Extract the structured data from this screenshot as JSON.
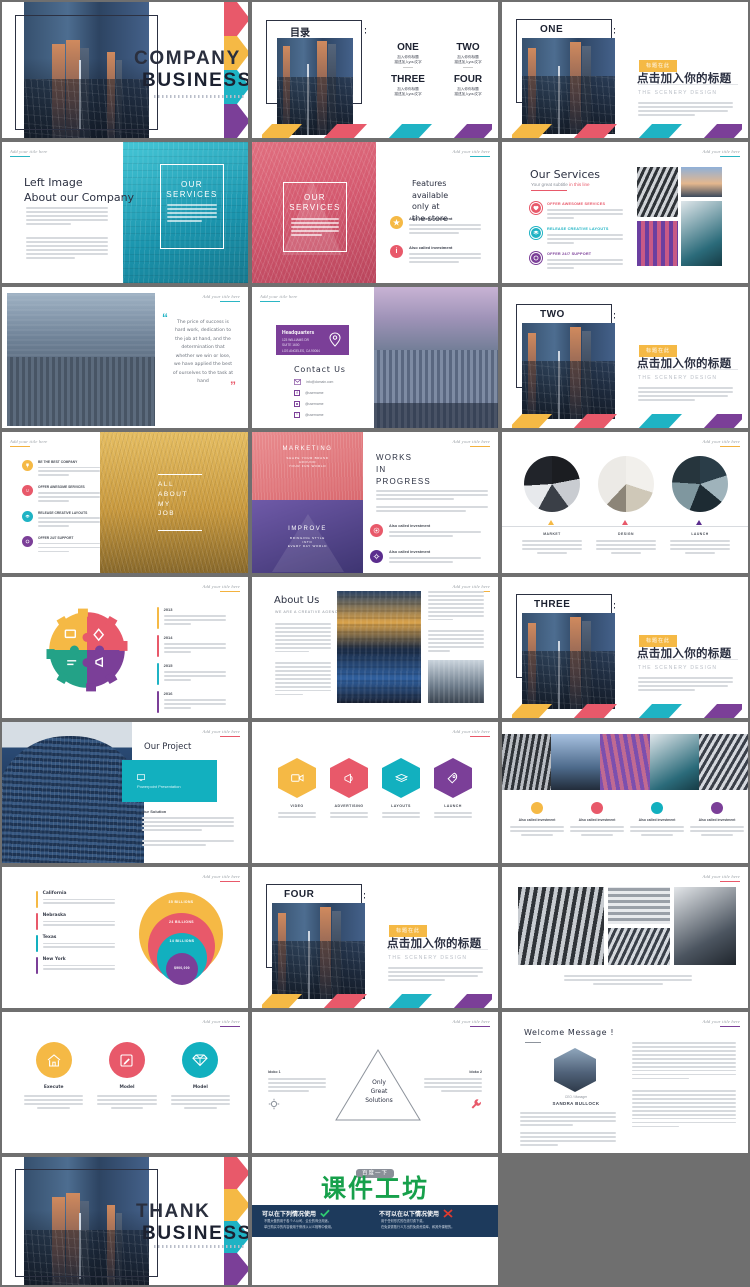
{
  "meta": {
    "accent_gold": "#f5b945",
    "accent_red": "#e8596a",
    "accent_teal": "#1fb3c4",
    "accent_purple": "#7b3f98",
    "ink": "#2c3142"
  },
  "common": {
    "add_title": "Add your title here"
  },
  "slides": {
    "cover": {
      "line1": "COMPANY",
      "line2": "BUSINESS"
    },
    "toc": {
      "title": "目录",
      "items": [
        {
          "num": "ONE",
          "l1": "加入你你标题",
          "l2": "描述加入you文字"
        },
        {
          "num": "TWO",
          "l1": "加入你你标题",
          "l2": "描述加入you文字"
        },
        {
          "num": "THREE",
          "l1": "加入你你标题",
          "l2": "描述加入you文字"
        },
        {
          "num": "FOUR",
          "l1": "加入你你标题",
          "l2": "描述加入you文字"
        }
      ]
    },
    "section_one": {
      "label": "ONE",
      "badge": "标题在此",
      "title": "点击加入你的标题",
      "sub": "THE SCENERY DESIGN"
    },
    "section_two": {
      "label": "TWO",
      "badge": "标题在此",
      "title": "点击加入你的标题",
      "sub": "THE SCENERY DESIGN"
    },
    "section_three": {
      "label": "THREE",
      "badge": "标题在此",
      "title": "点击加入你的标题",
      "sub": "THE SCENERY DESIGN"
    },
    "section_four": {
      "label": "FOUR",
      "badge": "标题在此",
      "title": "点击加入你的标题",
      "sub": "THE SCENERY DESIGN"
    },
    "left_image": {
      "title1": "Left Image",
      "title2": "About our Company",
      "overlay_title1": "OUR",
      "overlay_title2": "SERVICES"
    },
    "our_services_red": {
      "overlay_title1": "OUR",
      "overlay_title2": "SERVICES",
      "heading": [
        "Features",
        "available",
        "only at",
        "the store"
      ],
      "items": [
        {
          "label": "Also called investment",
          "color": "#f5b945",
          "icon": "star-icon"
        },
        {
          "label": "Also called investment",
          "color": "#e8596a",
          "icon": "info-icon"
        }
      ]
    },
    "our_services": {
      "title": "Our Services",
      "subtitle": "Your great subtitle",
      "subtitle_accent": "in this line",
      "items": [
        {
          "label": "OFFER AWESOME SERVICES",
          "color": "#e8596a",
          "icon": "heart-icon"
        },
        {
          "label": "RELEASE CREATIVE LAYOUTS",
          "color": "#1fb3c4",
          "icon": "layers-icon"
        },
        {
          "label": "OFFER 24/7 SUPPORT",
          "color": "#7b3f98",
          "icon": "support-icon"
        }
      ]
    },
    "quote": {
      "text": "The price of success is hard work, dedication to the job at hand, and the determination that whether we win or lose, we have applied the best of ourselves to the task at hand",
      "open_quote": "“",
      "close_quote": "”"
    },
    "contact": {
      "card_title": "Headquarters",
      "card_lines": [
        "123 WILLIAMS DR",
        "SUITE 1600",
        "LOS ANGELES, CA 90064"
      ],
      "title": "Contact Us",
      "rows": [
        {
          "icon": "mail-icon",
          "text": "info@domain.com"
        },
        {
          "icon": "facebook-icon",
          "text": "@username"
        },
        {
          "icon": "instagram-icon",
          "text": "@username"
        },
        {
          "icon": "twitter-icon",
          "text": "@username"
        }
      ]
    },
    "all_about_my_job": {
      "overlay": [
        "ALL",
        "ABOUT",
        "MY",
        "JOB"
      ],
      "items": [
        {
          "label": "BE THE BEST COMPANY",
          "color": "#f5b945",
          "icon": "trophy-icon"
        },
        {
          "label": "OFFER AWESOME SERVICES",
          "color": "#e8596a",
          "icon": "smile-icon"
        },
        {
          "label": "RELEASE CREATIVE LAYOUTS",
          "color": "#1fb3c4",
          "icon": "layers-icon"
        },
        {
          "label": "OFFER 24/7 SUPPORT",
          "color": "#7b3f98",
          "icon": "support-icon"
        }
      ]
    },
    "works_in_progress": {
      "overlay_top": [
        "MARKETING",
        "SHAPE YOUR BRAND",
        "AROUND",
        "YOUR FUN WORLD"
      ],
      "overlay_bottom": [
        "IMPROVE",
        "BRINGING STYLE",
        "INTO",
        "EVERY DAY WORLD"
      ],
      "heading": [
        "WORKS",
        "IN",
        "PROGRESS"
      ],
      "items": [
        {
          "label": "Also called investment",
          "color": "#e8596a",
          "icon": "target-icon"
        },
        {
          "label": "Also called investment",
          "color": "#5b2d8e",
          "icon": "gear-icon"
        }
      ]
    },
    "three_circles": {
      "items": [
        {
          "title": "MARKET",
          "color": "#f5b945",
          "icon": "pin-icon"
        },
        {
          "title": "DESIGN",
          "color": "#e8596a",
          "icon": "pin-icon"
        },
        {
          "title": "LAUNCH",
          "color": "#5b2d8e",
          "icon": "pin-icon"
        }
      ]
    },
    "puzzle_gears": {
      "years": [
        {
          "year": "2013",
          "color": "#f5b945",
          "icon": "chat-icon"
        },
        {
          "year": "2014",
          "color": "#e8596a",
          "icon": "diamond-icon"
        },
        {
          "year": "2015",
          "color": "#1fb3c4",
          "icon": "settings-icon"
        },
        {
          "year": "2016",
          "color": "#7b3f98",
          "icon": "megaphone-icon"
        }
      ]
    },
    "about_us": {
      "title": "About Us",
      "subtitle": "WE ARE A CREATIVE AGENCY"
    },
    "our_project": {
      "title": "Our Project",
      "card_icon": "screen-icon",
      "card_text": "Powerpoint Presentation",
      "section": "Our Solution"
    },
    "hex_row": {
      "items": [
        {
          "label": "VIDEO",
          "color": "#f5b945",
          "icon": "video-icon"
        },
        {
          "label": "ADVERTISING",
          "color": "#e8596a",
          "icon": "megaphone-icon"
        },
        {
          "label": "LAYOUTS",
          "color": "#1fb3c4",
          "icon": "layers-icon"
        },
        {
          "label": "LAUNCH",
          "color": "#7b3f98",
          "icon": "rocket-icon"
        }
      ]
    },
    "photo_strip": {
      "items": [
        {
          "label": "Also called investment",
          "color": "#f5b945"
        },
        {
          "label": "Also called investment",
          "color": "#e8596a"
        },
        {
          "label": "Also called investment",
          "color": "#1fb3c4"
        },
        {
          "label": "Also called investment",
          "color": "#7b3f98"
        }
      ]
    },
    "states_chart": {
      "legend": [
        {
          "name": "California",
          "color": "#f5b945",
          "value": "35 BILLIONS"
        },
        {
          "name": "Nebraska",
          "color": "#e8596a",
          "value": "24 BILLIONS"
        },
        {
          "name": "Texas",
          "color": "#1fb3c4",
          "value": "14 BILLIONS"
        },
        {
          "name": "New York",
          "color": "#7b3f98",
          "value": "$900,000"
        }
      ]
    },
    "architecture_grid": {
      "caption": "Id a amount of the features you could need into one economy a stunning presentation with unlimited colors"
    },
    "three_round_icons": {
      "items": [
        {
          "label": "Execute",
          "color": "#f5b945",
          "icon": "home-icon"
        },
        {
          "label": "Model",
          "color": "#e8596a",
          "icon": "pencil-icon"
        },
        {
          "label": "Model",
          "color": "#1fb3c4",
          "icon": "diamond-icon"
        }
      ]
    },
    "triangle_solutions": {
      "center": [
        "Only",
        "Great",
        "Solutions"
      ],
      "left_label": "Idoko 1",
      "right_label": "Idoko 2",
      "left_icon": "gear-icon",
      "right_icon": "wrench-icon"
    },
    "welcome_message": {
      "title": "Welcome Message !",
      "role": "CEO / Manager",
      "name": "SANDRA BULLOCK"
    },
    "thanks": {
      "line1": "THANK",
      "line2": "BUSINESS"
    }
  },
  "promo": {
    "badge": "百度一下",
    "title": "课件工坊",
    "ok_heading": "可以在下列情况使用",
    "ok_icon": "check-icon",
    "ok_items": [
      "不限大做的用于各个人公司、企业的商业用途。",
      "单日购买中的内容使用于修改以以义相等中使用。"
    ],
    "no_heading": "不可以在以下情况使用",
    "no_icon": "cross-icon",
    "no_items": [
      "用于任何形式的在线付费下载。",
      "在免费需散行义方出的免费资源库，和其外课程的。"
    ]
  }
}
